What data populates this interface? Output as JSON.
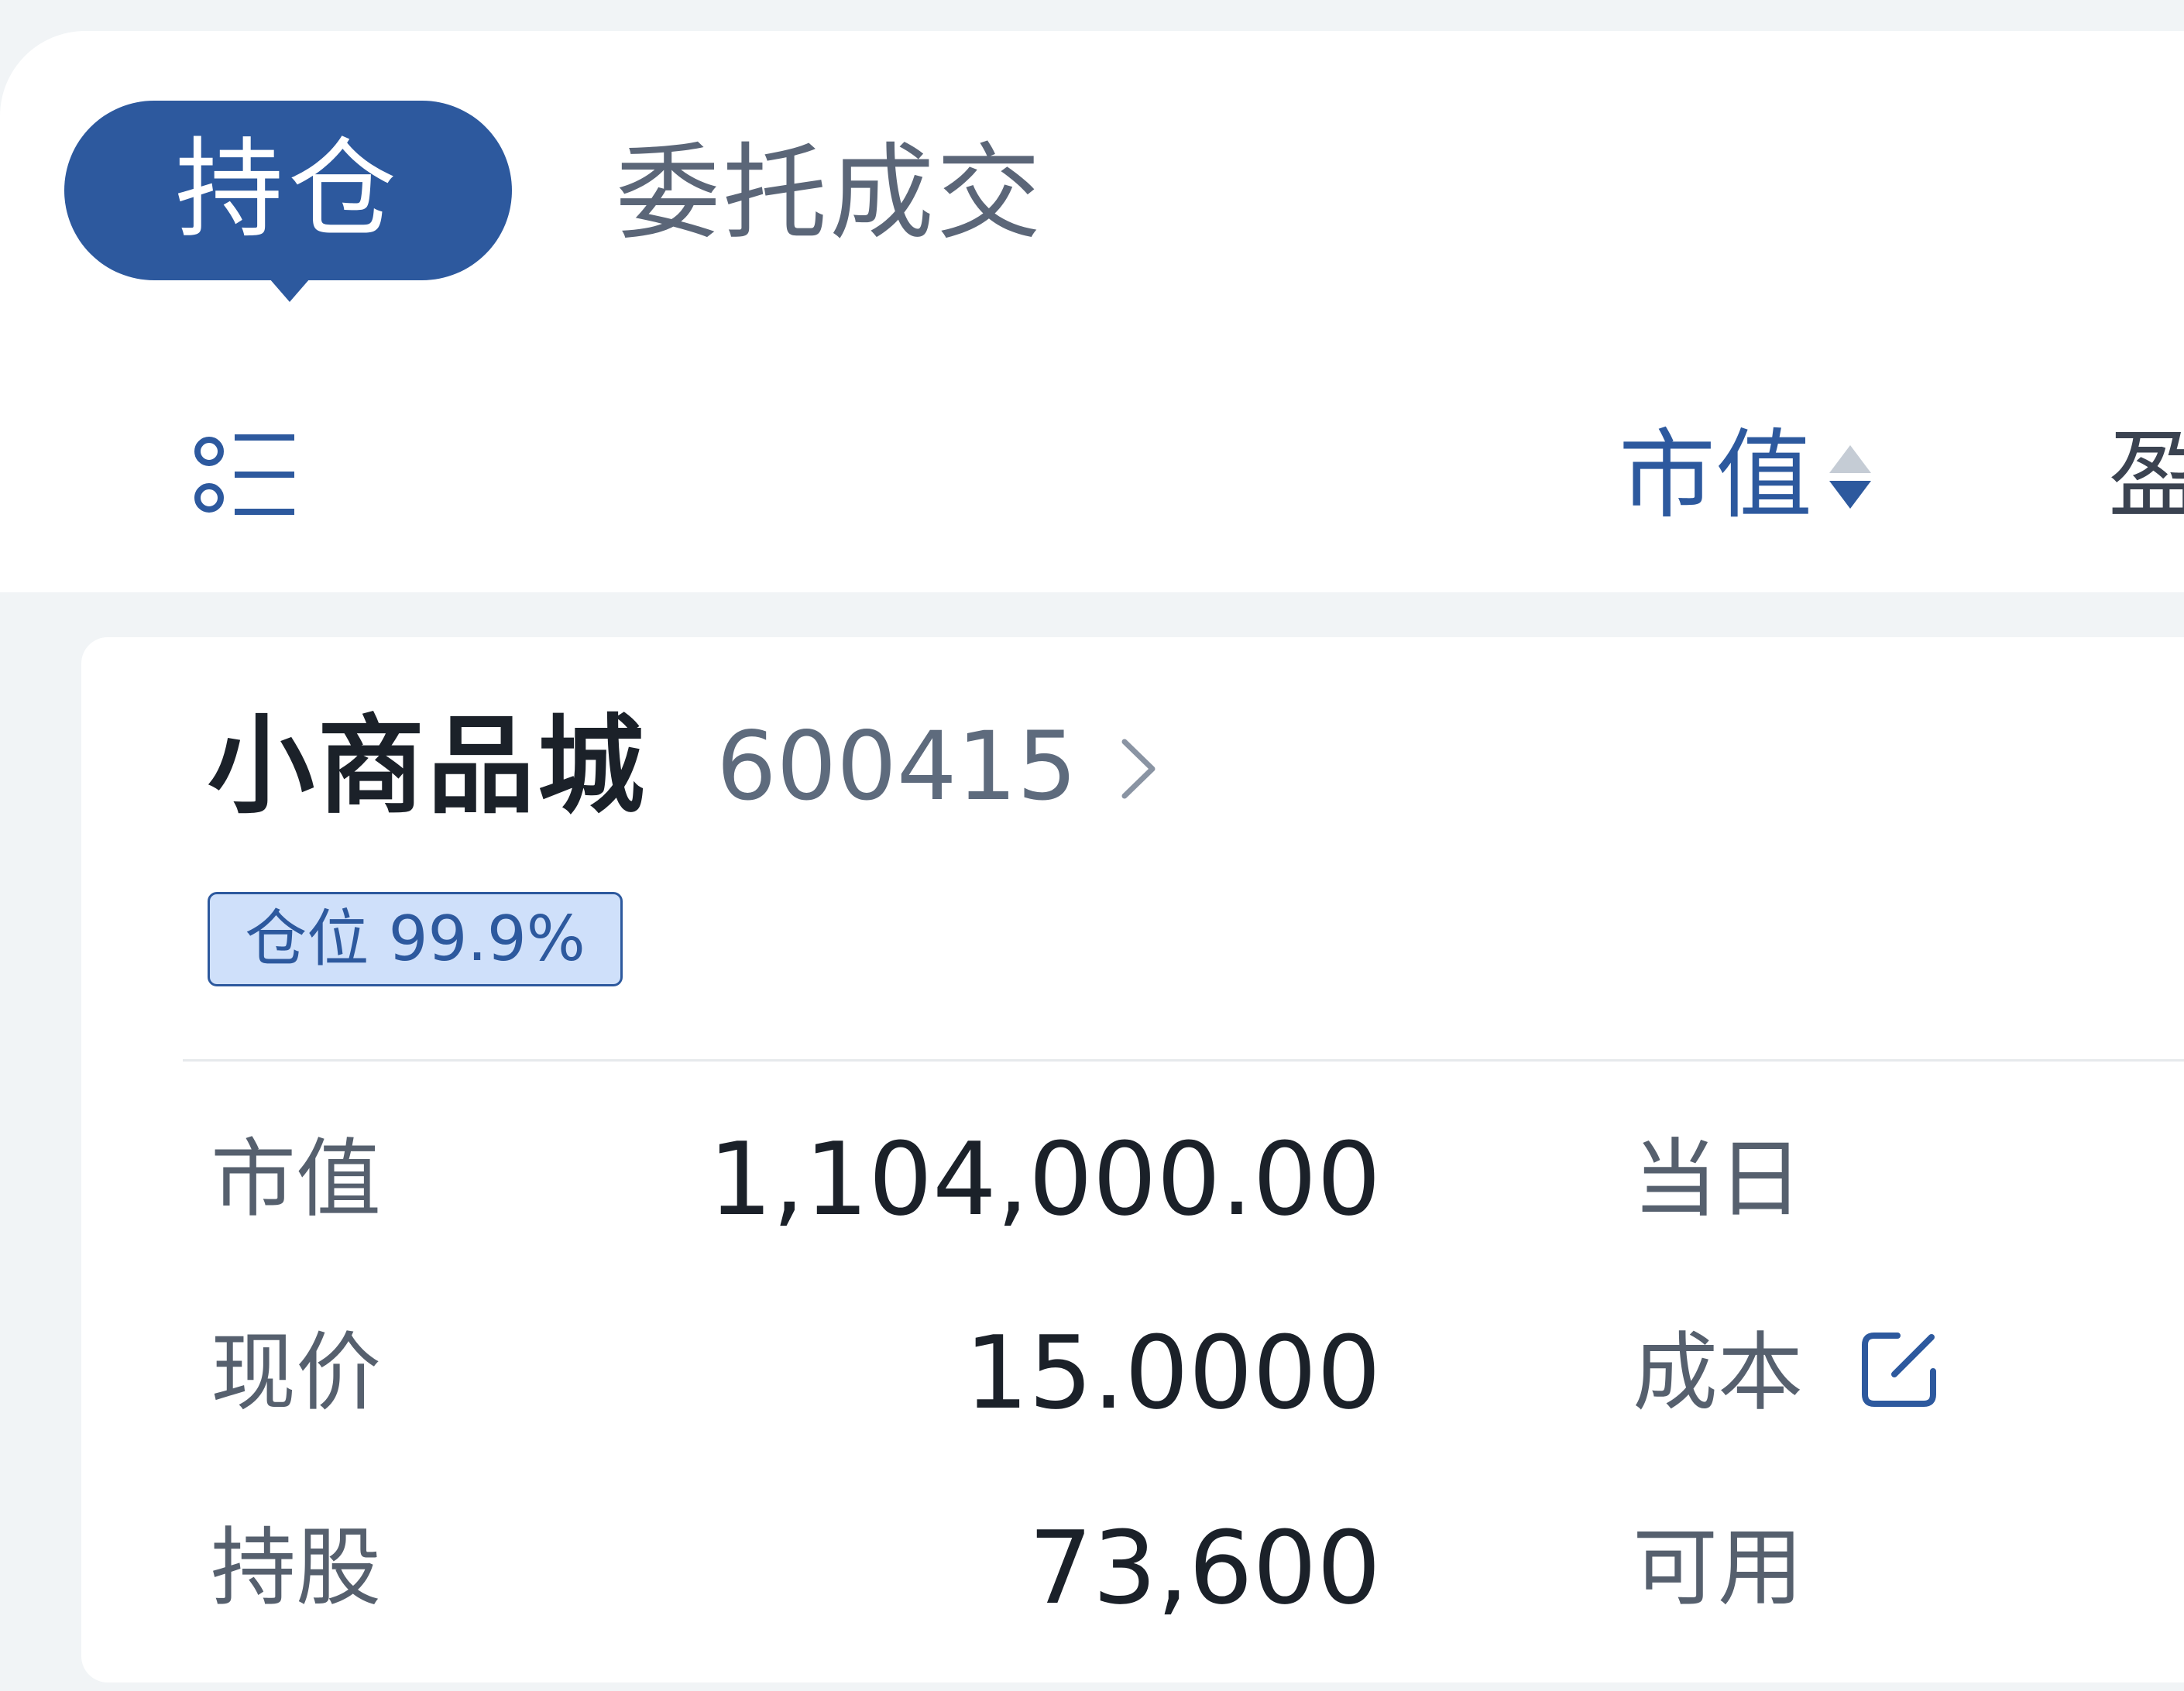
{
  "tabs": [
    {
      "label": "持仓",
      "active": true
    },
    {
      "label": "委托成交",
      "active": false
    }
  ],
  "list_header": {
    "list_icon": "list-icon",
    "sort_column_label": "市值",
    "sort_icon": "sort-icon",
    "next_column_label": "盈"
  },
  "holding": {
    "name": "小商品城",
    "code": "600415",
    "chevron_icon": "chevron-right-icon",
    "position_badge": "仓位 99.9%",
    "left_rows": [
      {
        "label": "市值",
        "value": "1,104,000.00"
      },
      {
        "label": "现价",
        "value": "15.0000"
      },
      {
        "label": "持股",
        "value": "73,600"
      }
    ],
    "right_rows": [
      {
        "label": "当日"
      },
      {
        "label": "成本",
        "icon": "edit-icon"
      },
      {
        "label": "可用"
      }
    ]
  },
  "colors": {
    "accent": "#2d599e",
    "background": "#f1f4f6",
    "badge_fill": "#cfe0fa"
  }
}
